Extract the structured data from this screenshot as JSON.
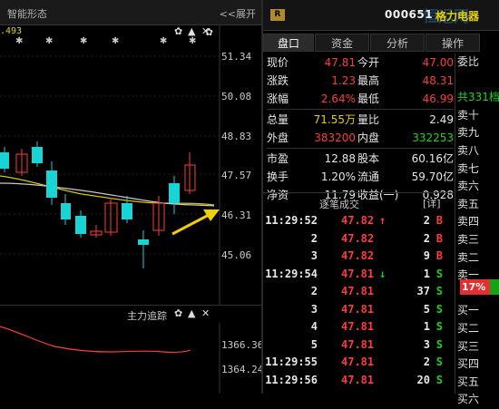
{
  "left": {
    "title": "智能形态",
    "expand": "<<展开",
    "top_value": ".493",
    "axis": [
      "51.34",
      "50.08",
      "48.83",
      "47.57",
      "46.31",
      "45.06"
    ],
    "indicator_title": "主力追踪",
    "indicator_axis": [
      "1366.36",
      "1364.24"
    ],
    "icon_gear": "✿",
    "icon_close": "✕"
  },
  "right": {
    "badge": "R",
    "code": "000651",
    "name": "格力电器",
    "watermark": "恒运网",
    "tabs": [
      "盘口",
      "资金",
      "分析",
      "操作"
    ],
    "quote": [
      {
        "l1": "现价",
        "v1": "47.81",
        "c1": "red",
        "l2": "今开",
        "v2": "47.00",
        "c2": "red"
      },
      {
        "l1": "涨跌",
        "v1": "1.23",
        "c1": "red",
        "l2": "最高",
        "v2": "48.31",
        "c2": "red"
      },
      {
        "l1": "涨幅",
        "v1": "2.64%",
        "c1": "red",
        "l2": "最低",
        "v2": "46.99",
        "c2": "red"
      },
      {
        "l1": "总量",
        "v1": "71.55万",
        "c1": "yellow",
        "l2": "量比",
        "v2": "2.49",
        "c2": "white"
      },
      {
        "l1": "外盘",
        "v1": "383200",
        "c1": "red",
        "l2": "内盘",
        "v2": "332253",
        "c2": "green"
      },
      {
        "l1": "市盈",
        "v1": "12.88",
        "c1": "white",
        "l2": "股本",
        "v2": "60.16亿",
        "c2": "white"
      },
      {
        "l1": "换手",
        "v1": "1.20%",
        "c1": "white",
        "l2": "流通",
        "v2": "59.70亿",
        "c2": "white"
      },
      {
        "l1": "净资",
        "v1": "11.79",
        "c1": "white",
        "l2": "收益(一)",
        "v2": "0.928",
        "c2": "white"
      }
    ],
    "deal_title": "逐笔成交",
    "deal_detail": "[详]",
    "deals": [
      {
        "time": "11:29:52",
        "price": "47.82",
        "arrow": "↑",
        "vol": "2",
        "bs": "B"
      },
      {
        "time": "2",
        "price": "47.82",
        "arrow": "",
        "vol": "2",
        "bs": "B"
      },
      {
        "time": "3",
        "price": "47.82",
        "arrow": "",
        "vol": "9",
        "bs": "B"
      },
      {
        "time": "11:29:54",
        "price": "47.81",
        "arrow": "↓",
        "vol": "1",
        "bs": "S"
      },
      {
        "time": "2",
        "price": "47.81",
        "arrow": "",
        "vol": "37",
        "bs": "S"
      },
      {
        "time": "3",
        "price": "47.81",
        "arrow": "",
        "vol": "5",
        "bs": "S"
      },
      {
        "time": "4",
        "price": "47.81",
        "arrow": "",
        "vol": "1",
        "bs": "S"
      },
      {
        "time": "5",
        "price": "47.81",
        "arrow": "",
        "vol": "3",
        "bs": "S"
      },
      {
        "time": "11:29:55",
        "price": "47.81",
        "arrow": "",
        "vol": "2",
        "bs": "S"
      },
      {
        "time": "11:29:56",
        "price": "47.81",
        "arrow": "",
        "vol": "20",
        "bs": "S"
      }
    ],
    "orderbook": [
      "委比",
      "",
      "共331档",
      "卖十",
      "卖九",
      "卖八",
      "卖七",
      "卖六",
      "卖五",
      "卖四",
      "卖三",
      "卖二",
      "卖一",
      "",
      "买一",
      "买二",
      "买三",
      "买四",
      "买五",
      "买六"
    ],
    "wei_bi": "17%"
  }
}
